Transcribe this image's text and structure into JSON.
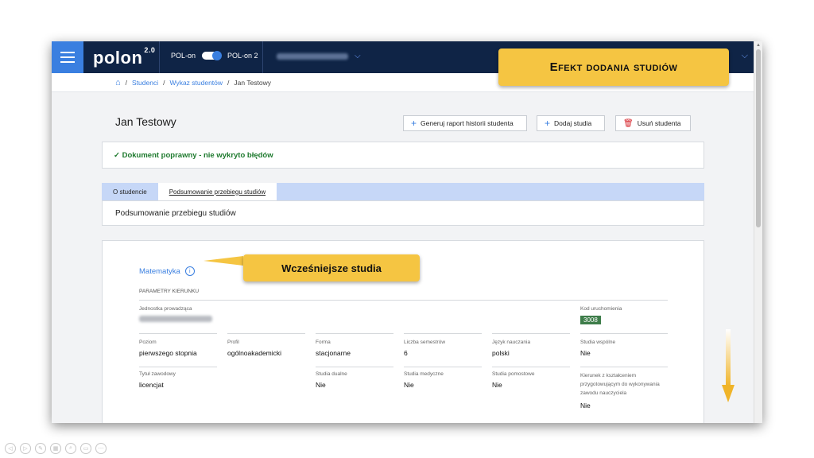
{
  "header": {
    "logo_text": "pol",
    "logo_text_o": "on",
    "logo_version": "2.0",
    "toggle_left_label": "POL-on",
    "toggle_right_label": "POL-on 2",
    "institution_blurred": "Politechnika Warszawska"
  },
  "breadcrumb": {
    "items": [
      "Studenci",
      "Wykaz studentów",
      "Jan Testowy"
    ],
    "separator": "/"
  },
  "page": {
    "title": "Jan Testowy",
    "buttons": {
      "report": "Generuj raport historii studenta",
      "add_studies": "Dodaj studia",
      "delete_student": "Usuń studenta"
    },
    "status_message": "✓ Dokument poprawny - nie wykryto błędów",
    "tabs": [
      {
        "label": "O studencie",
        "active": false
      },
      {
        "label": "Podsumowanie przebiegu studiów",
        "active": true
      }
    ],
    "summary_title": "Podsumowanie przebiegu studiów"
  },
  "study": {
    "course_name": "Matematyka",
    "params_title": "PARAMETRY KIERUNKU",
    "unit_label": "Jednostka prowadząca",
    "unit_value_blurred": "Politechnika Warszawska",
    "code_label": "Kod uruchomienia",
    "code_value": "3008",
    "row1": [
      {
        "label": "Poziom",
        "value": "pierwszego stopnia"
      },
      {
        "label": "Profil",
        "value": "ogólnoakademicki"
      },
      {
        "label": "Forma",
        "value": "stacjonarne"
      },
      {
        "label": "Liczba semestrów",
        "value": "6"
      },
      {
        "label": "Język nauczania",
        "value": "polski"
      },
      {
        "label": "Studia wspólne",
        "value": "Nie"
      }
    ],
    "row2": [
      {
        "label": "Tytuł zawodowy",
        "value": "licencjat"
      },
      {
        "label": "Studia dualne",
        "value": "Nie"
      },
      {
        "label": "Studia medyczne",
        "value": "Nie"
      },
      {
        "label": "Studia pomostowe",
        "value": "Nie"
      },
      {
        "label": "Kierunek z kształceniem przygotowującym do wykonywania zawodu nauczyciela",
        "value": "Nie"
      }
    ]
  },
  "callouts": {
    "header": "Efekt dodania studiów",
    "earlier_studies": "Wcześniejsze studia"
  },
  "colors": {
    "topbar": "#0f2446",
    "accent": "#3a7fe0",
    "callout": "#f5c542",
    "success": "#1e7a2e",
    "danger": "#d6232a"
  }
}
